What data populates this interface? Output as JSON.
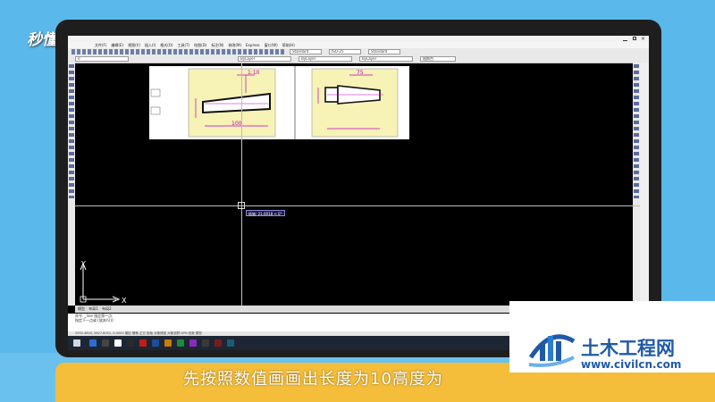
{
  "watermark": {
    "logo_text": "秒懂视频"
  },
  "app": {
    "menu": [
      "文件(F)",
      "编辑(E)",
      "视图(V)",
      "插入(I)",
      "格式(O)",
      "工具(T)",
      "绘图(D)",
      "标注(N)",
      "修改(M)",
      "Express",
      "窗口(W)",
      "帮助(H)"
    ],
    "toolbar_combos": [
      "Standard",
      "ISO-25",
      "Standard"
    ],
    "layer_combos": [
      "ByLayer",
      "ByLayer",
      "ByLayer",
      "随颜色"
    ],
    "layer_state": "0",
    "drawing": {
      "dim_left": "1:10",
      "dim_len": "100",
      "dim_right": "75"
    },
    "cursor_tooltip": "极轴: 21.0018 < 0°",
    "ucs": {
      "x_label": "X",
      "y_label": "Y"
    },
    "layout_tabs": [
      "模型",
      "布局1",
      "布局2"
    ],
    "command_lines": [
      "命令: _line 指定第一点:",
      "指定下一点或 [放弃(U)]:"
    ],
    "status_text": "2993.4600, 5627.8001, 0.0000   捕捉  栅格  正交  极轴  对象捕捉  对象追踪  DYN  线宽  模型",
    "taskbar_colors": [
      "#2b6cd6",
      "#444",
      "#ffffff",
      "#2a2a2a",
      "#c31c1c",
      "#1a4fa0",
      "#c87d00",
      "#1f8a3a",
      "#8a2ac0",
      "#3a3a3a",
      "#7a1c1c",
      "#1c5a7a"
    ]
  },
  "subtitle": {
    "text": "先按照数值画画出长度为10高度为"
  },
  "brand": {
    "name": "土木工程网",
    "url": "www.civilcn.com",
    "color": "#1f5aa8"
  }
}
